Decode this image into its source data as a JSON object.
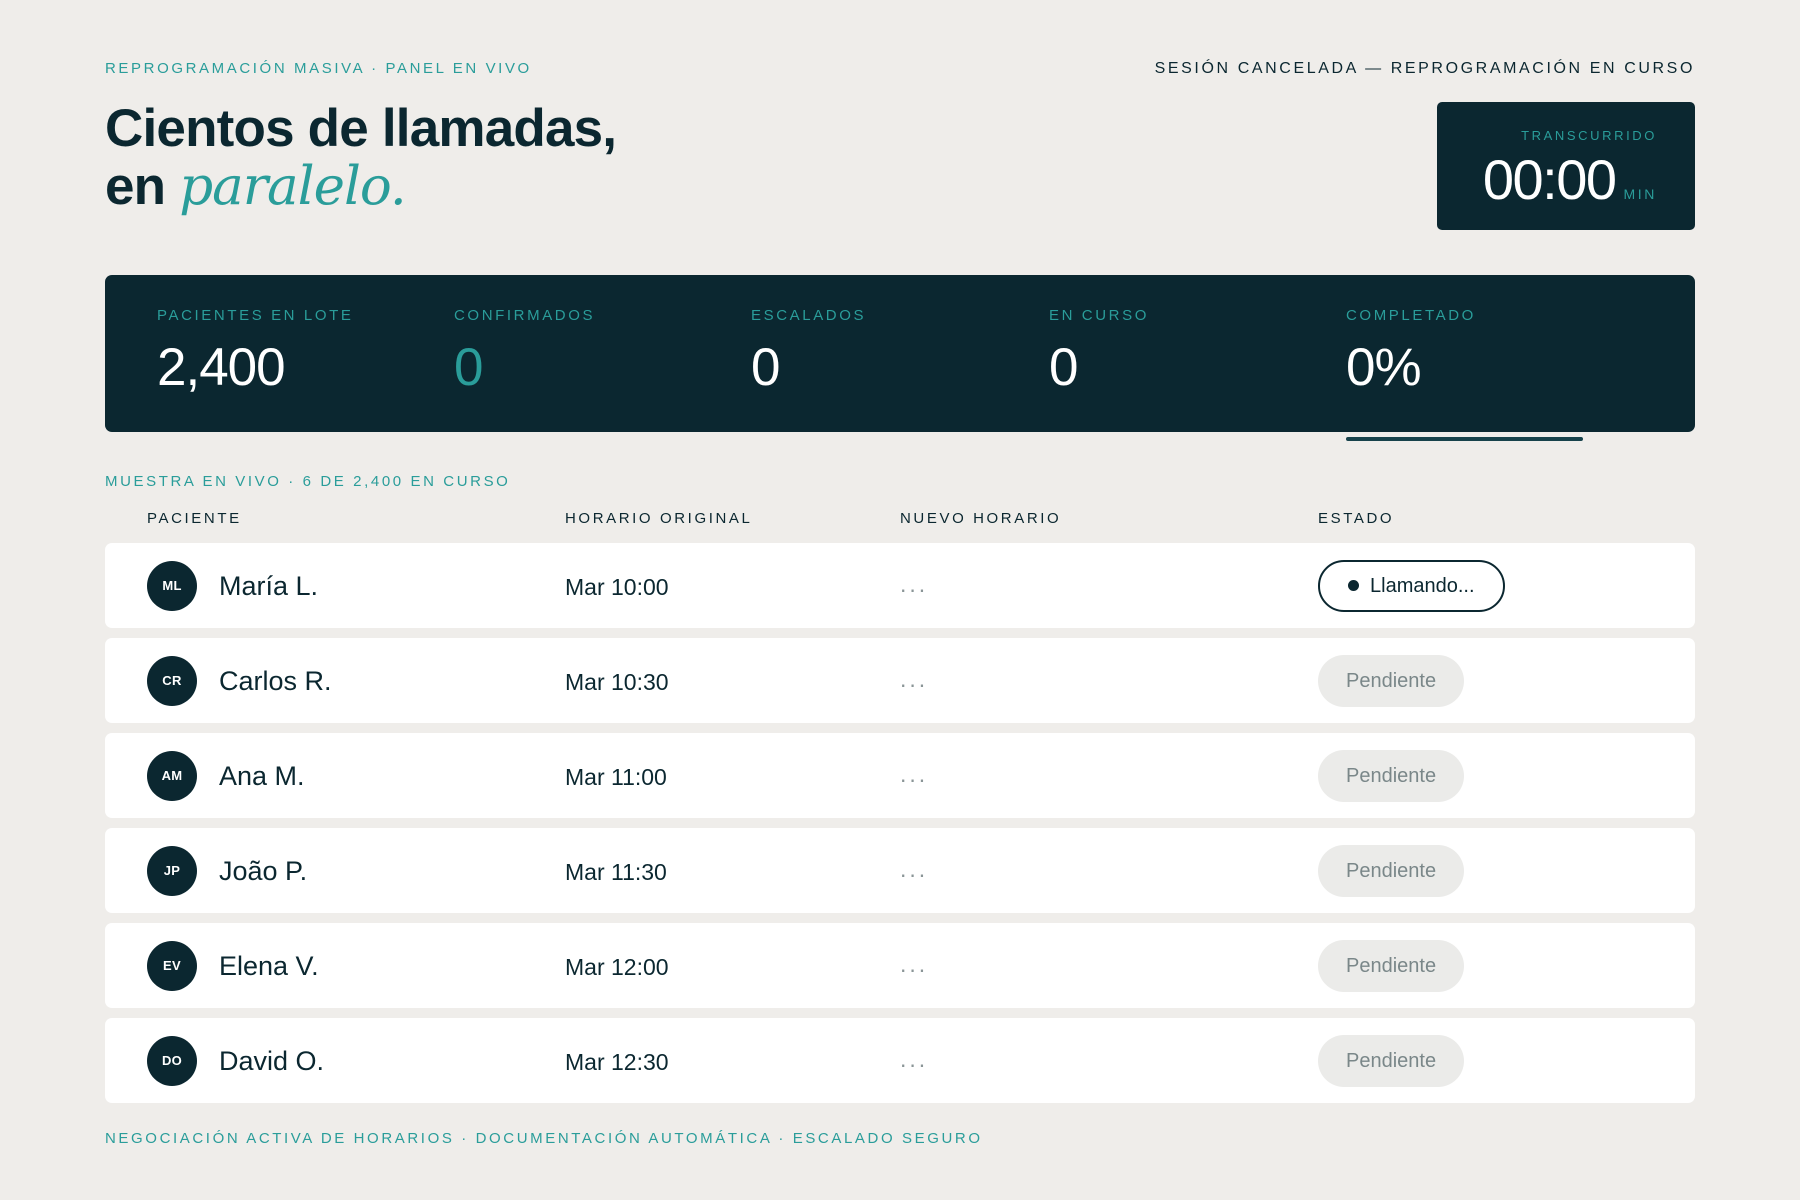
{
  "header": {
    "eyebrow": "REPROGRAMACIÓN MASIVA · PANEL EN VIVO",
    "session_status": "SESIÓN CANCELADA — REPROGRAMACIÓN EN CURSO",
    "title_line1": "Cientos de llamadas,",
    "title_line2_prefix": "en ",
    "title_line2_accent": "paralelo."
  },
  "timer": {
    "label": "TRANSCURRIDO",
    "value": "00:00",
    "unit": "MIN"
  },
  "stats": {
    "batch": {
      "label": "PACIENTES EN LOTE",
      "value": "2,400"
    },
    "confirmed": {
      "label": "CONFIRMADOS",
      "value": "0"
    },
    "escalated": {
      "label": "ESCALADOS",
      "value": "0"
    },
    "in_progress": {
      "label": "EN CURSO",
      "value": "0"
    },
    "completed": {
      "label": "COMPLETADO",
      "value": "0%",
      "progress_percent": 0
    }
  },
  "sample": {
    "label": "MUESTRA EN VIVO · 6 DE 2,400 EN CURSO"
  },
  "table": {
    "headers": {
      "patient": "PACIENTE",
      "original": "HORARIO ORIGINAL",
      "new": "NUEVO HORARIO",
      "status": "ESTADO"
    },
    "rows": [
      {
        "initials": "ML",
        "name": "María L.",
        "original": "Mar 10:00",
        "new": "...",
        "status": "Llamando...",
        "state": "calling"
      },
      {
        "initials": "CR",
        "name": "Carlos R.",
        "original": "Mar 10:30",
        "new": "...",
        "status": "Pendiente",
        "state": "pending"
      },
      {
        "initials": "AM",
        "name": "Ana M.",
        "original": "Mar 11:00",
        "new": "...",
        "status": "Pendiente",
        "state": "pending"
      },
      {
        "initials": "JP",
        "name": "João P.",
        "original": "Mar 11:30",
        "new": "...",
        "status": "Pendiente",
        "state": "pending"
      },
      {
        "initials": "EV",
        "name": "Elena V.",
        "original": "Mar 12:00",
        "new": "...",
        "status": "Pendiente",
        "state": "pending"
      },
      {
        "initials": "DO",
        "name": "David O.",
        "original": "Mar 12:30",
        "new": "...",
        "status": "Pendiente",
        "state": "pending"
      }
    ]
  },
  "footer": {
    "text": "NEGOCIACIÓN ACTIVA DE HORARIOS · DOCUMENTACIÓN AUTOMÁTICA · ESCALADO SEGURO"
  },
  "colors": {
    "navy": "#0b2730",
    "teal": "#2a9d9a",
    "background": "#efedea"
  }
}
